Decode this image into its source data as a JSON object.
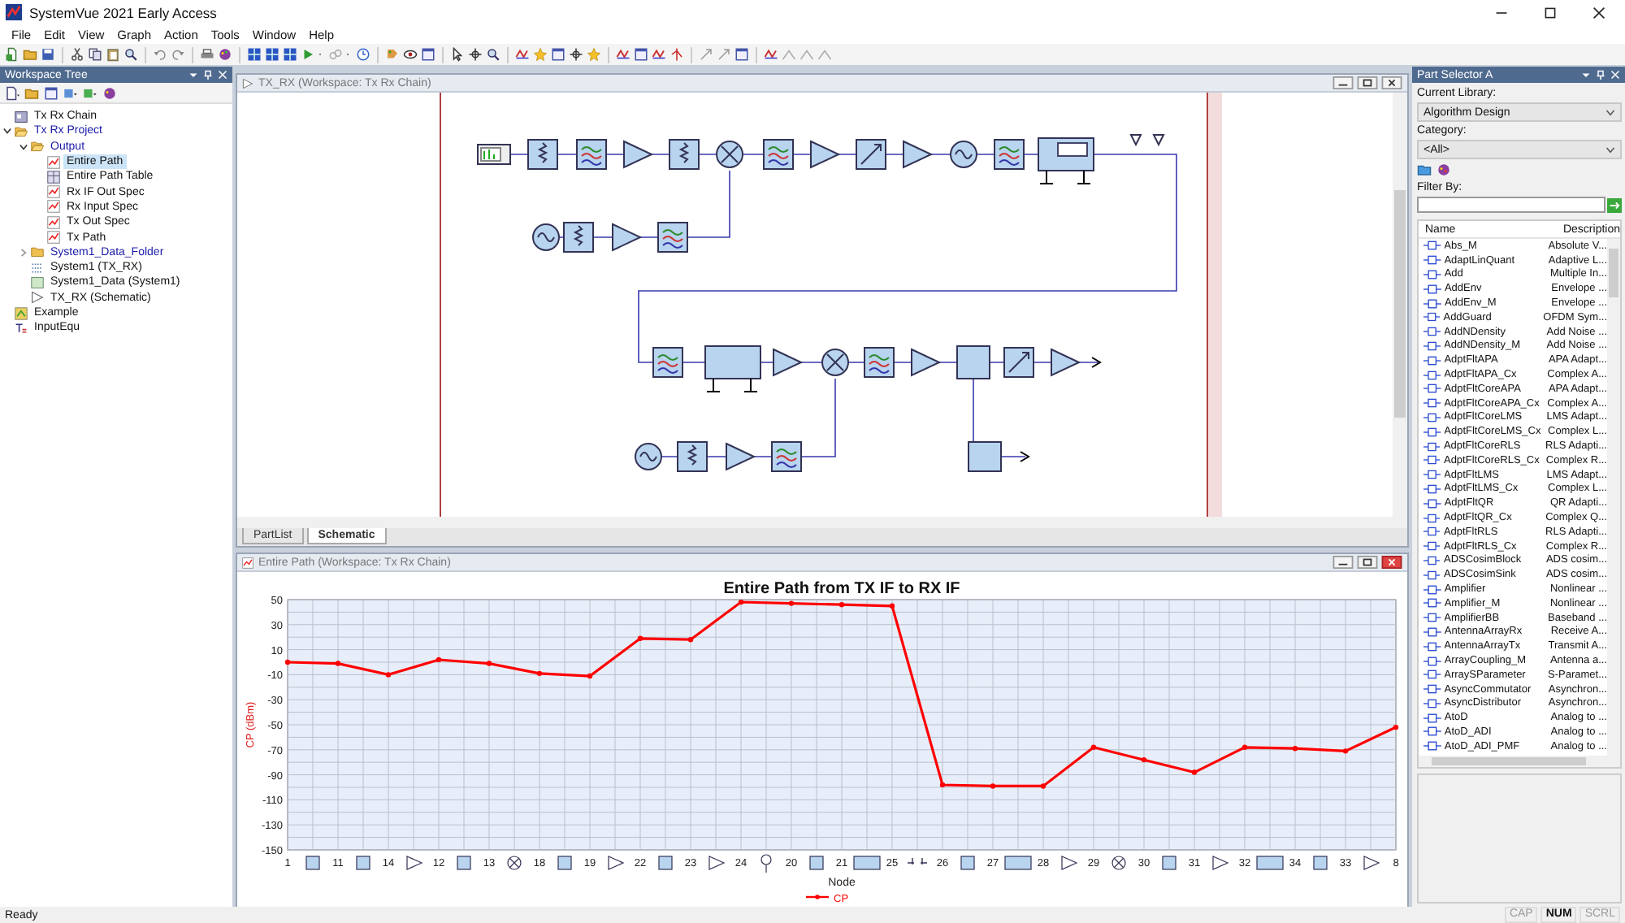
{
  "window": {
    "title": "SystemVue 2021 Early Access"
  },
  "menu": [
    "File",
    "Edit",
    "View",
    "Graph",
    "Action",
    "Tools",
    "Window",
    "Help"
  ],
  "workspace_tree": {
    "title": "Workspace Tree",
    "items": [
      {
        "label": "Tx Rx Chain",
        "kind": "workspace",
        "selected": false
      },
      {
        "label": "Tx Rx Project",
        "kind": "folder",
        "expanded": true,
        "selected": false,
        "children": [
          {
            "label": "Output",
            "kind": "folder",
            "expanded": true,
            "selected": false,
            "children": [
              {
                "label": "Entire Path",
                "kind": "graph",
                "selected": true
              },
              {
                "label": "Entire Path Table",
                "kind": "table",
                "selected": false
              },
              {
                "label": "Rx IF Out Spec",
                "kind": "graph",
                "selected": false
              },
              {
                "label": "Rx Input Spec",
                "kind": "graph",
                "selected": false
              },
              {
                "label": "Tx Out Spec",
                "kind": "graph",
                "selected": false
              },
              {
                "label": "Tx Path",
                "kind": "graph",
                "selected": false
              }
            ]
          },
          {
            "label": "System1_Data_Folder",
            "kind": "folder",
            "expanded": false,
            "selected": false
          },
          {
            "label": "System1 (TX_RX)",
            "kind": "system",
            "selected": false
          },
          {
            "label": "System1_Data (System1)",
            "kind": "data",
            "selected": false
          },
          {
            "label": "TX_RX (Schematic)",
            "kind": "schematic",
            "selected": false
          }
        ]
      },
      {
        "label": "Example",
        "kind": "example",
        "selected": false
      },
      {
        "label": "InputEqu",
        "kind": "equation",
        "selected": false
      }
    ]
  },
  "schematic_window": {
    "title": "TX_RX (Workspace: Tx Rx Chain)",
    "tabs": [
      {
        "label": "PartList",
        "selected": false
      },
      {
        "label": "Schematic",
        "selected": true
      }
    ]
  },
  "graph_window": {
    "title": "Entire Path (Workspace: Tx Rx Chain)",
    "chart_data": {
      "type": "line",
      "title": "Entire Path from TX IF to RX IF",
      "xlabel": "Node",
      "ylabel": "CP (dBm)",
      "categories": [
        "1",
        "11",
        "14",
        "12",
        "13",
        "18",
        "19",
        "22",
        "23",
        "24",
        "20",
        "21",
        "25",
        "26",
        "27",
        "28",
        "29",
        "30",
        "31",
        "32",
        "34",
        "33",
        "8"
      ],
      "series": [
        {
          "name": "CP",
          "color": "#ff0000",
          "marker": true,
          "values": [
            0,
            -1,
            -10,
            2,
            -1,
            -9,
            -11,
            19,
            18,
            48,
            47,
            46,
            45,
            -98,
            -99,
            -99,
            -68,
            -78,
            -88,
            -68,
            -69,
            -71,
            -52
          ]
        }
      ],
      "grid": true,
      "ylim": [
        -150,
        50
      ],
      "yticks": [
        50,
        30,
        10,
        -10,
        -30,
        -50,
        -70,
        -90,
        -110,
        -130,
        -150
      ]
    }
  },
  "part_selector": {
    "title": "Part Selector A",
    "library_label": "Current Library:",
    "library": "Algorithm Design",
    "category_label": "Category:",
    "category": "<All>",
    "filter_label": "Filter By:",
    "columns": [
      "Name",
      "Description"
    ],
    "rows": [
      {
        "name": "Abs_M",
        "description": "Absolute V..."
      },
      {
        "name": "AdaptLinQuant",
        "description": "Adaptive L..."
      },
      {
        "name": "Add",
        "description": "Multiple In..."
      },
      {
        "name": "AddEnv",
        "description": "Envelope ..."
      },
      {
        "name": "AddEnv_M",
        "description": "Envelope ..."
      },
      {
        "name": "AddGuard",
        "description": "OFDM Sym..."
      },
      {
        "name": "AddNDensity",
        "description": "Add Noise ..."
      },
      {
        "name": "AddNDensity_M",
        "description": "Add Noise ..."
      },
      {
        "name": "AdptFltAPA",
        "description": "APA Adapt..."
      },
      {
        "name": "AdptFltAPA_Cx",
        "description": "Complex A..."
      },
      {
        "name": "AdptFltCoreAPA",
        "description": "APA Adapt..."
      },
      {
        "name": "AdptFltCoreAPA_Cx",
        "description": "Complex A..."
      },
      {
        "name": "AdptFltCoreLMS",
        "description": "LMS Adapt..."
      },
      {
        "name": "AdptFltCoreLMS_Cx",
        "description": "Complex L..."
      },
      {
        "name": "AdptFltCoreRLS",
        "description": "RLS Adapti..."
      },
      {
        "name": "AdptFltCoreRLS_Cx",
        "description": "Complex R..."
      },
      {
        "name": "AdptFltLMS",
        "description": "LMS Adapt..."
      },
      {
        "name": "AdptFltLMS_Cx",
        "description": "Complex L..."
      },
      {
        "name": "AdptFltQR",
        "description": "QR Adapti..."
      },
      {
        "name": "AdptFltQR_Cx",
        "description": "Complex Q..."
      },
      {
        "name": "AdptFltRLS",
        "description": "RLS Adapti..."
      },
      {
        "name": "AdptFltRLS_Cx",
        "description": "Complex R..."
      },
      {
        "name": "ADSCosimBlock",
        "description": "ADS cosim..."
      },
      {
        "name": "ADSCosimSink",
        "description": "ADS cosim..."
      },
      {
        "name": "Amplifier",
        "description": "Nonlinear ..."
      },
      {
        "name": "Amplifier_M",
        "description": "Nonlinear ..."
      },
      {
        "name": "AmplifierBB",
        "description": "Baseband ..."
      },
      {
        "name": "AntennaArrayRx",
        "description": "Receive A..."
      },
      {
        "name": "AntennaArrayTx",
        "description": "Transmit A..."
      },
      {
        "name": "ArrayCoupling_M",
        "description": "Antenna a..."
      },
      {
        "name": "ArraySParameter",
        "description": "S-Paramet..."
      },
      {
        "name": "AsyncCommutator",
        "description": "Asynchron..."
      },
      {
        "name": "AsyncDistributor",
        "description": "Asynchron..."
      },
      {
        "name": "AtoD",
        "description": "Analog to ..."
      },
      {
        "name": "AtoD_ADI",
        "description": "Analog to ..."
      },
      {
        "name": "AtoD_ADI_PMF",
        "description": "Analog to ..."
      }
    ]
  },
  "status_bar": {
    "text": "Ready",
    "indicators": [
      {
        "label": "CAP",
        "on": false
      },
      {
        "label": "NUM",
        "on": true
      },
      {
        "label": "SCRL",
        "on": false
      }
    ]
  }
}
